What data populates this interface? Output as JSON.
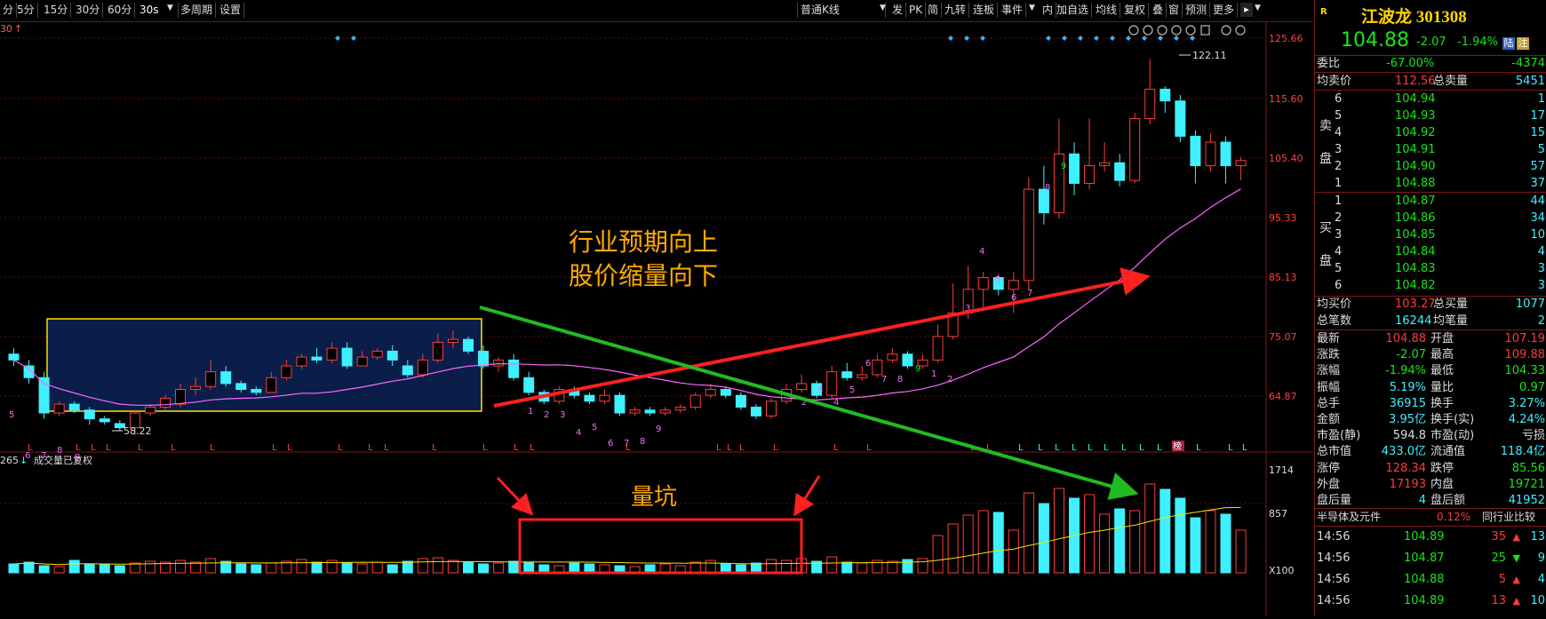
{
  "toolbar": {
    "periods": [
      "分",
      "5分",
      "15分",
      "30分",
      "60分",
      "30s",
      "多周期",
      "设置"
    ],
    "selected_period": "30s",
    "kline_type": "普通K线",
    "buttons": [
      "发",
      "PK",
      "简",
      "九转",
      "连板",
      "事件",
      "内",
      "加自选",
      "均线",
      "复权",
      "叠",
      "窗",
      "预测",
      "更多"
    ]
  },
  "chart": {
    "period_label": "30",
    "max_label": "122.11",
    "min_label": "58.22",
    "price_ticks": [
      "125.66",
      "115.60",
      "105.40",
      "95.33",
      "85.13",
      "75.07",
      "64.87"
    ],
    "annotation_main": [
      "行业预期向上",
      "股价缩量向下"
    ],
    "annotation_volume": "量坑",
    "volume_title_left": "265",
    "volume_title": "成交量已复权",
    "volume_ticks": [
      "1714",
      "857",
      "X100"
    ],
    "bottom_letter": "L",
    "bang_label": "榜",
    "colors": {
      "up": "#ff3b3b",
      "down": "#3ff0ff",
      "ma": "#ff66ff",
      "box": "#ffe000",
      "boxfill": "#0b1e4a",
      "green_arrow": "#22bb22",
      "red_arrow": "#ff2020"
    }
  },
  "quote": {
    "logo": "R",
    "name_code": "江波龙 301308",
    "price": "104.88",
    "change": "-2.07",
    "pct": "-1.94%",
    "tags": [
      "陆",
      "注"
    ],
    "weibi_label": "委比",
    "weibi": "-67.00%",
    "weicha": "-4374",
    "avg_sell_label": "均卖价",
    "avg_sell": "112.56",
    "total_sell_label": "总卖量",
    "total_sell": "5451",
    "sell_side_label": [
      "卖",
      "盘"
    ],
    "sells": [
      {
        "lvl": "6",
        "price": "104.94",
        "vol": "1"
      },
      {
        "lvl": "5",
        "price": "104.93",
        "vol": "17"
      },
      {
        "lvl": "4",
        "price": "104.92",
        "vol": "15"
      },
      {
        "lvl": "3",
        "price": "104.91",
        "vol": "5"
      },
      {
        "lvl": "2",
        "price": "104.90",
        "vol": "57"
      },
      {
        "lvl": "1",
        "price": "104.88",
        "vol": "37"
      }
    ],
    "buy_side_label": [
      "买",
      "盘"
    ],
    "buys": [
      {
        "lvl": "1",
        "price": "104.87",
        "vol": "44"
      },
      {
        "lvl": "2",
        "price": "104.86",
        "vol": "34"
      },
      {
        "lvl": "3",
        "price": "104.85",
        "vol": "10"
      },
      {
        "lvl": "4",
        "price": "104.84",
        "vol": "4"
      },
      {
        "lvl": "5",
        "price": "104.83",
        "vol": "3"
      },
      {
        "lvl": "6",
        "price": "104.82",
        "vol": "3"
      }
    ],
    "avg_buy_label": "均买价",
    "avg_buy": "103.27",
    "total_buy_label": "总买量",
    "total_buy": "1077",
    "total_trades_label": "总笔数",
    "total_trades": "16244",
    "avg_trade_label": "均笔量",
    "avg_trade": "2",
    "stats": [
      {
        "l1": "最新",
        "v1": "104.88",
        "c1": "red",
        "l2": "开盘",
        "v2": "107.19",
        "c2": "red"
      },
      {
        "l1": "涨跌",
        "v1": "-2.07",
        "c1": "green",
        "l2": "最高",
        "v2": "109.88",
        "c2": "red"
      },
      {
        "l1": "涨幅",
        "v1": "-1.94%",
        "c1": "green",
        "l2": "最低",
        "v2": "104.33",
        "c2": "green"
      },
      {
        "l1": "振幅",
        "v1": "5.19%",
        "c1": "cyan",
        "l2": "量比",
        "v2": "0.97",
        "c2": "green"
      },
      {
        "l1": "总手",
        "v1": "36915",
        "c1": "cyan",
        "l2": "换手",
        "v2": "3.27%",
        "c2": "cyan"
      },
      {
        "l1": "金额",
        "v1": "3.95亿",
        "c1": "cyan",
        "l2": "换手(实)",
        "v2": "4.24%",
        "c2": "cyan"
      },
      {
        "l1": "市盈(静)",
        "v1": "594.8",
        "c1": "white",
        "l2": "市盈(动)",
        "v2": "亏损",
        "c2": "white"
      },
      {
        "l1": "总市值",
        "v1": "433.0亿",
        "c1": "cyan",
        "l2": "流通值",
        "v2": "118.4亿",
        "c2": "cyan"
      },
      {
        "l1": "涨停",
        "v1": "128.34",
        "c1": "red",
        "l2": "跌停",
        "v2": "85.56",
        "c2": "green"
      },
      {
        "l1": "外盘",
        "v1": "17193",
        "c1": "red",
        "l2": "内盘",
        "v2": "19721",
        "c2": "green"
      },
      {
        "l1": "盘后量",
        "v1": "4",
        "c1": "cyan",
        "l2": "盘后额",
        "v2": "41952",
        "c2": "cyan"
      }
    ],
    "sector_name": "半导体及元件",
    "sector_pct": "0.12%",
    "sector_compare": "同行业比较",
    "ticks": [
      {
        "time": "14:56",
        "price": "104.89",
        "vol": "35",
        "dir": "up",
        "num": "13"
      },
      {
        "time": "14:56",
        "price": "104.87",
        "vol": "25",
        "dir": "down",
        "num": "9"
      },
      {
        "time": "14:56",
        "price": "104.88",
        "vol": "5",
        "dir": "up",
        "num": "4"
      },
      {
        "time": "14:56",
        "price": "104.89",
        "vol": "13",
        "dir": "up",
        "num": "10"
      }
    ]
  }
}
